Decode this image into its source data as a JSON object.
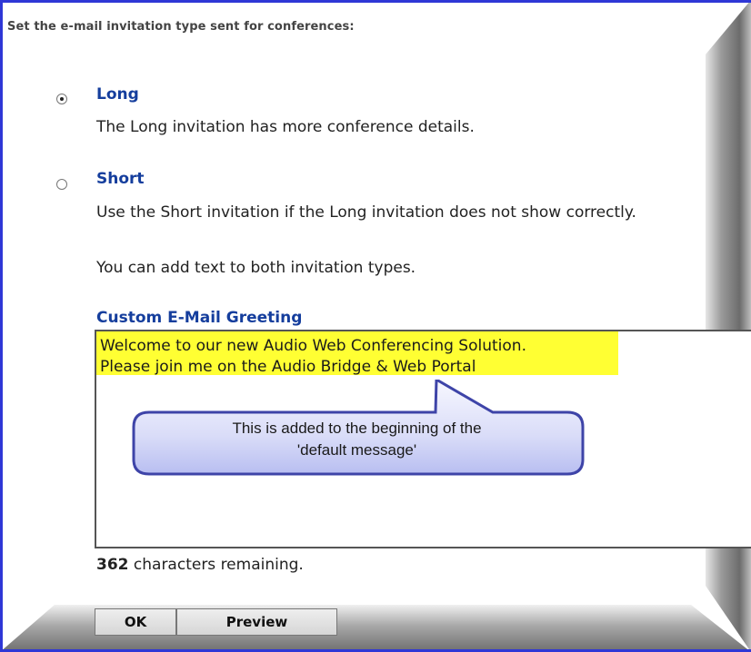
{
  "header": {
    "caption": "Set the e-mail invitation type sent for conferences:"
  },
  "options": [
    {
      "title": "Long",
      "description": "The Long invitation has more conference details.",
      "selected": true
    },
    {
      "title": "Short",
      "description": "Use the Short invitation if the Long invitation does not show correctly.",
      "selected": false
    }
  ],
  "info": {
    "note": "You can add text to both invitation types."
  },
  "greeting": {
    "title": "Custom E-Mail Greeting",
    "lines": [
      "Welcome to our new Audio Web Conferencing Solution.",
      "Please join me on the Audio Bridge & Web Portal"
    ],
    "highlight_color": "#ffff33"
  },
  "callout": {
    "line1": "This is added to the beginning of the",
    "line2": "'default message'"
  },
  "status": {
    "remaining_count": "362",
    "remaining_suffix": " characters remaining."
  },
  "buttons": {
    "ok": "OK",
    "preview": "Preview"
  },
  "colors": {
    "border": "#2f37d6",
    "title_blue": "#153e9d"
  }
}
